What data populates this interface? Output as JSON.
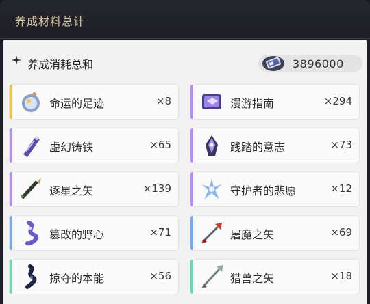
{
  "header": {
    "title": "养成材料总计"
  },
  "summary": {
    "label": "养成消耗总和",
    "credit_value": "3896000",
    "icons": {
      "star": "sparkle-icon",
      "credit": "credit-icon"
    }
  },
  "accent_colors": {
    "gold": "#f0c34a",
    "purple": "#b491f0",
    "blue": "#79a9e8",
    "teal": "#6fd6ad"
  },
  "materials": [
    {
      "name": "命运的足迹",
      "qty": "×8",
      "accent": "gold",
      "icon": "destiny-footprint-icon"
    },
    {
      "name": "漫游指南",
      "qty": "×294",
      "accent": "purple",
      "icon": "travel-guide-icon"
    },
    {
      "name": "虚幻铸铁",
      "qty": "×65",
      "accent": "purple",
      "icon": "illusory-iron-icon"
    },
    {
      "name": "践踏的意志",
      "qty": "×73",
      "accent": "purple",
      "icon": "trampled-will-icon"
    },
    {
      "name": "逐星之矢",
      "qty": "×139",
      "accent": "purple",
      "icon": "star-chasing-arrow-icon"
    },
    {
      "name": "守护者的悲愿",
      "qty": "×12",
      "accent": "purple",
      "icon": "guardian-lament-icon"
    },
    {
      "name": "篡改的野心",
      "qty": "×71",
      "accent": "blue",
      "icon": "tampered-ambition-icon"
    },
    {
      "name": "屠魔之矢",
      "qty": "×69",
      "accent": "blue",
      "icon": "demon-slaying-arrow-icon"
    },
    {
      "name": "掠夺的本能",
      "qty": "×56",
      "accent": "teal",
      "icon": "plunder-instinct-icon"
    },
    {
      "name": "猎兽之矢",
      "qty": "×18",
      "accent": "teal",
      "icon": "hunting-arrow-icon"
    }
  ]
}
